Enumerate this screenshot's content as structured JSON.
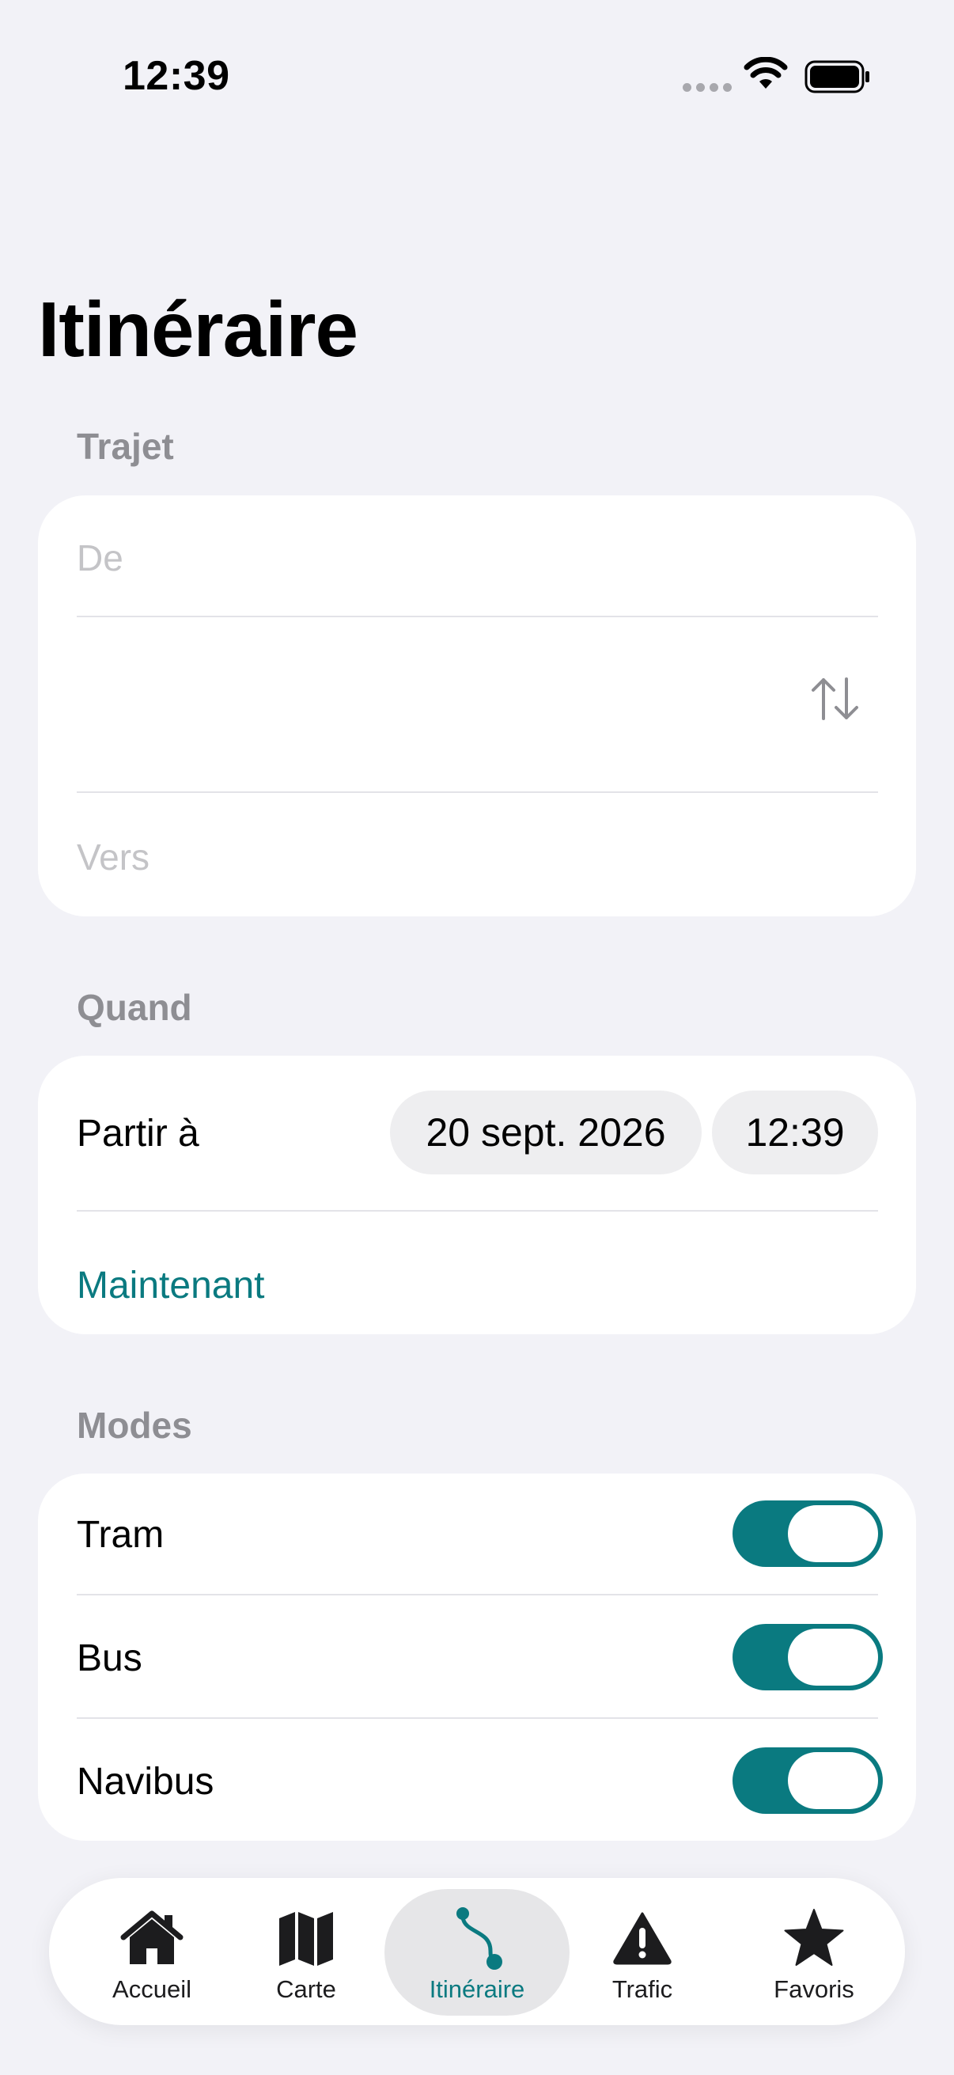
{
  "status_bar": {
    "time": "12:39",
    "icons": [
      "signal-icon",
      "wifi-icon",
      "battery-icon"
    ]
  },
  "page": {
    "title": "Itinéraire"
  },
  "trajet": {
    "header": "Trajet",
    "from_placeholder": "De",
    "to_placeholder": "Vers",
    "swap_icon": "swap-vertical-icon"
  },
  "quand": {
    "header": "Quand",
    "label": "Partir à",
    "date": "20 sept. 2026",
    "time": "12:39",
    "now_link": "Maintenant"
  },
  "modes": {
    "header": "Modes",
    "items": [
      {
        "label": "Tram",
        "enabled": true
      },
      {
        "label": "Bus",
        "enabled": true
      },
      {
        "label": "Navibus",
        "enabled": true
      }
    ]
  },
  "tab_bar": {
    "tabs": [
      {
        "label": "Accueil",
        "icon": "house-icon",
        "active": false
      },
      {
        "label": "Carte",
        "icon": "map-icon",
        "active": false
      },
      {
        "label": "Itinéraire",
        "icon": "route-icon",
        "active": true
      },
      {
        "label": "Trafic",
        "icon": "warning-icon",
        "active": false
      },
      {
        "label": "Favoris",
        "icon": "star-icon",
        "active": false
      }
    ]
  },
  "colors": {
    "accent": "#0A7A80",
    "background": "#F2F2F7",
    "card": "#FFFFFF",
    "section_header": "#8E8E93",
    "placeholder": "#C4C4C7"
  }
}
